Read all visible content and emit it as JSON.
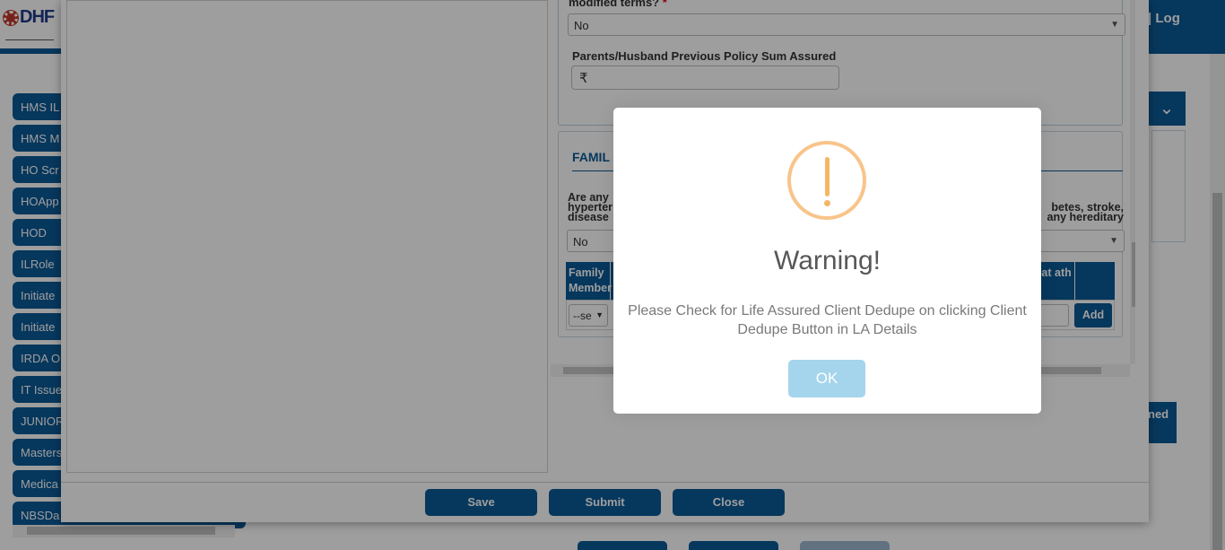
{
  "header": {
    "brand": "DHF",
    "logout_label": "| Log"
  },
  "sidebar": {
    "items": [
      {
        "label": "HMS IL"
      },
      {
        "label": "HMS M"
      },
      {
        "label": "HO Scr"
      },
      {
        "label": "HOApp"
      },
      {
        "label": "HOD"
      },
      {
        "label": "ILRole"
      },
      {
        "label": "Initiate"
      },
      {
        "label": "Initiate"
      },
      {
        "label": "IRDA O"
      },
      {
        "label": "IT Issue"
      },
      {
        "label": "JUNIOR"
      },
      {
        "label": "Masters"
      },
      {
        "label": "Medica"
      },
      {
        "label": "NBSDa"
      }
    ]
  },
  "right_panel": {
    "chevron": "chevron-down-icon",
    "tab_label": "ned"
  },
  "form": {
    "question1_label": "modified terms?",
    "question1_value": "No",
    "sum_assured_label": "Parents/Husband Previous Policy Sum Assured",
    "currency_symbol": "₹",
    "family_section_title": "FAMIL",
    "question2_line1_left": "Are any",
    "question2_line1_right": "betes, stroke,",
    "question2_line2_left": "hyperter",
    "question2_line2_right": "any hereditary",
    "question2_line3_left": "disease",
    "question2_value": "No",
    "table": {
      "col1_header": "Family Member",
      "col_age_header": "e at ath",
      "row_select_value": "--se",
      "add_label": "Add"
    }
  },
  "footer": {
    "save_label": "Save",
    "submit_label": "Submit",
    "close_label": "Close"
  },
  "alert": {
    "icon": "warning-exclamation-icon",
    "title": "Warning!",
    "message": "Please Check for Life Assured Client Dedupe on clicking Client Dedupe Button in LA Details",
    "ok_label": "OK",
    "accent_color": "#f8c48a",
    "ok_color": "#a5d5ec"
  },
  "colors": {
    "primary": "#0b5a97",
    "overlay": "rgba(0,0,0,0.38)"
  }
}
